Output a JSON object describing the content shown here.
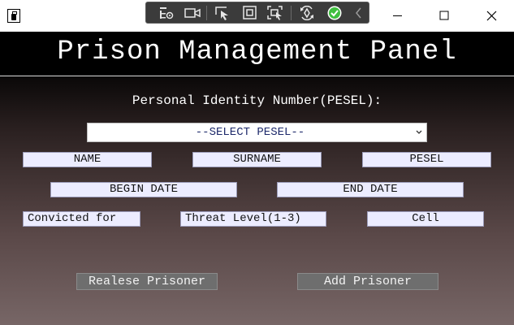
{
  "window": {
    "title": "",
    "icons": {
      "app": "app-icon",
      "minimize": "minimize-icon",
      "maximize": "maximize-icon",
      "close": "close-icon"
    }
  },
  "debug_toolbar": {
    "tools": [
      "live-visual-tree-icon",
      "record-icon",
      "select-element-icon",
      "display-layout-icon",
      "track-focus-icon",
      "hot-reload-icon",
      "checkmark-icon",
      "collapse-chevron-icon"
    ]
  },
  "header": {
    "title": "Prison Management Panel"
  },
  "form": {
    "pesel_label": "Personal Identity Number(PESEL):",
    "pesel_select": "--SELECT PESEL--",
    "name": "NAME",
    "surname": "SURNAME",
    "pesel": "PESEL",
    "begin_date": "BEGIN DATE",
    "end_date": "END DATE",
    "convicted_for": "Convicted for",
    "threat_level": "Threat Level(1-3)",
    "cell": "Cell"
  },
  "actions": {
    "release": "Realese Prisoner",
    "add": "Add Prisoner"
  },
  "colors": {
    "header_bg": "#000000",
    "field_bg": "#ececff",
    "button_bg": "#6e6e6e",
    "check_green": "#3fbf3f"
  }
}
